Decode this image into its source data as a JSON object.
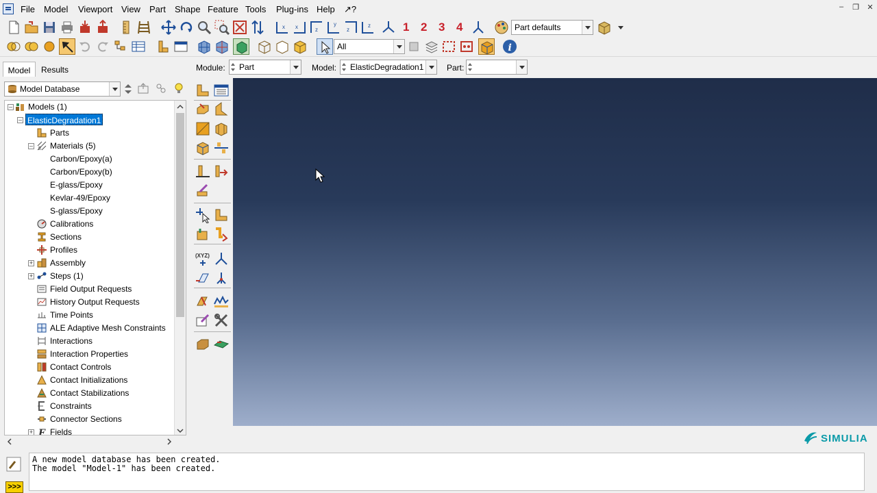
{
  "menubar": {
    "items": [
      "File",
      "Model",
      "Viewport",
      "View",
      "Part",
      "Shape",
      "Feature",
      "Tools",
      "Plug-ins",
      "Help",
      "↗?"
    ]
  },
  "toolbar": {
    "view_numbers": [
      "1",
      "2",
      "3",
      "4"
    ],
    "part_defaults": "Part defaults",
    "selection_filter": "All"
  },
  "tabs": [
    "Model",
    "Results"
  ],
  "tree": {
    "database_select": "Model Database",
    "nodes": [
      {
        "label": "Models (1)",
        "icon": "models-icon"
      },
      {
        "label": "ElasticDegradation1",
        "icon": "none"
      },
      {
        "label": "Parts",
        "icon": "parts-icon"
      },
      {
        "label": "Materials (5)",
        "icon": "materials-icon"
      },
      {
        "label": "Carbon/Epoxy(a)",
        "icon": "none"
      },
      {
        "label": "Carbon/Epoxy(b)",
        "icon": "none"
      },
      {
        "label": "E-glass/Epoxy",
        "icon": "none"
      },
      {
        "label": "Kevlar-49/Epoxy",
        "icon": "none"
      },
      {
        "label": "S-glass/Epoxy",
        "icon": "none"
      },
      {
        "label": "Calibrations",
        "icon": "calibrations-icon"
      },
      {
        "label": "Sections",
        "icon": "sections-icon"
      },
      {
        "label": "Profiles",
        "icon": "profiles-icon"
      },
      {
        "label": "Assembly",
        "icon": "assembly-icon"
      },
      {
        "label": "Steps (1)",
        "icon": "steps-icon"
      },
      {
        "label": "Field Output Requests",
        "icon": "field-output-icon"
      },
      {
        "label": "History Output Requests",
        "icon": "history-output-icon"
      },
      {
        "label": "Time Points",
        "icon": "time-points-icon"
      },
      {
        "label": "ALE Adaptive Mesh Constraints",
        "icon": "ale-icon"
      },
      {
        "label": "Interactions",
        "icon": "interactions-icon"
      },
      {
        "label": "Interaction Properties",
        "icon": "interaction-properties-icon"
      },
      {
        "label": "Contact Controls",
        "icon": "contact-controls-icon"
      },
      {
        "label": "Contact Initializations",
        "icon": "contact-init-icon"
      },
      {
        "label": "Contact Stabilizations",
        "icon": "contact-stab-icon"
      },
      {
        "label": "Constraints",
        "icon": "constraints-icon"
      },
      {
        "label": "Connector Sections",
        "icon": "connector-icon"
      },
      {
        "label": "Fields",
        "icon": "fields-icon"
      }
    ]
  },
  "context": {
    "module_label": "Module:",
    "module_value": "Part",
    "model_label": "Model:",
    "model_value": "ElasticDegradation1",
    "part_label": "Part:",
    "part_value": ""
  },
  "messages": {
    "line1": "A new model database has been created.",
    "line2": "The model \"Model-1\" has been created."
  },
  "brand": {
    "name": "SIMULIA"
  },
  "colors": {
    "accent": "#0078d7",
    "viewport_top": "#1f2d49",
    "viewport_bottom": "#9eaecb",
    "brand": "#0a9aa8",
    "view_numbers": "#c8202a"
  }
}
